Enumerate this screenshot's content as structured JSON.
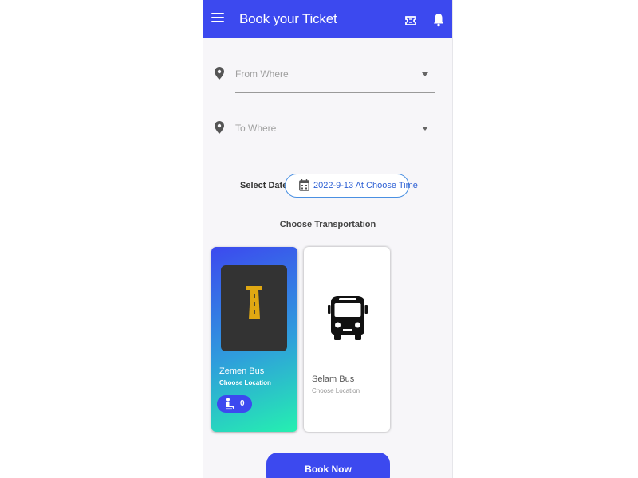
{
  "header": {
    "title": "Book your Ticket",
    "accent_color": "#3c49ef",
    "icons": [
      "menu-icon",
      "ticket-icon",
      "bell-icon"
    ]
  },
  "form": {
    "from": {
      "placeholder": "From Where",
      "icon": "location-pin-icon"
    },
    "to": {
      "placeholder": "To Where",
      "icon": "location-pin-icon"
    },
    "date_label": "Select Date",
    "date_value": "2022-9-13 At Choose Time",
    "date_icon": "calendar-icon"
  },
  "transport": {
    "title": "Choose Transportation",
    "cards": [
      {
        "name": "Zemen Bus",
        "location": "Choose Location",
        "seats": "0",
        "selected": true,
        "icon": "zemen-logo-icon"
      },
      {
        "name": "Selam Bus",
        "location": "Choose Location",
        "selected": false,
        "icon": "bus-icon"
      }
    ]
  },
  "actions": {
    "book_label": "Book Now"
  }
}
